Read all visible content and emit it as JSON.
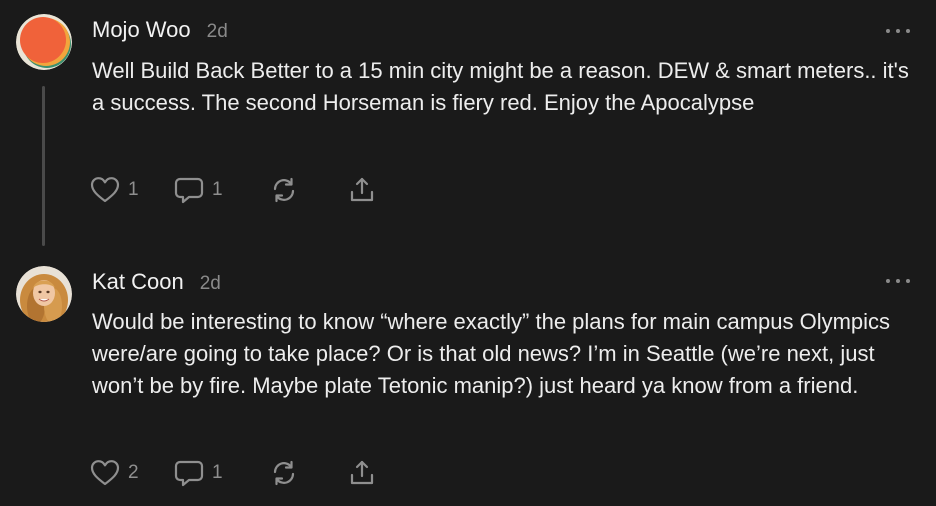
{
  "comments": [
    {
      "author": "Mojo Woo",
      "timestamp": "2d",
      "avatar_icon": "orange-circle-avatar",
      "text": "Well Build Back Better to a 15 min city might be a reason. DEW & smart meters.. it's a success. The second Horseman is fiery red. Enjoy the Apocalypse",
      "likes": "1",
      "replies": "1"
    },
    {
      "author": "Kat Coon",
      "timestamp": "2d",
      "avatar_icon": "blonde-woman-avatar",
      "text": "Would be interesting to know “where exactly” the plans for main campus Olympics were/are going to take place? Or is that old news? I’m in Seattle (we’re next, just won’t be by fire. Maybe plate Tetonic manip?) just heard ya know from a friend.",
      "likes": "2",
      "replies": "1"
    }
  ],
  "colors": {
    "background": "#1a1a1a",
    "text": "#ededed",
    "muted": "#8a8a8a",
    "thread_line": "#4a4a4a"
  },
  "icons": [
    "heart-icon",
    "comment-icon",
    "restack-icon",
    "share-icon",
    "more-icon"
  ]
}
